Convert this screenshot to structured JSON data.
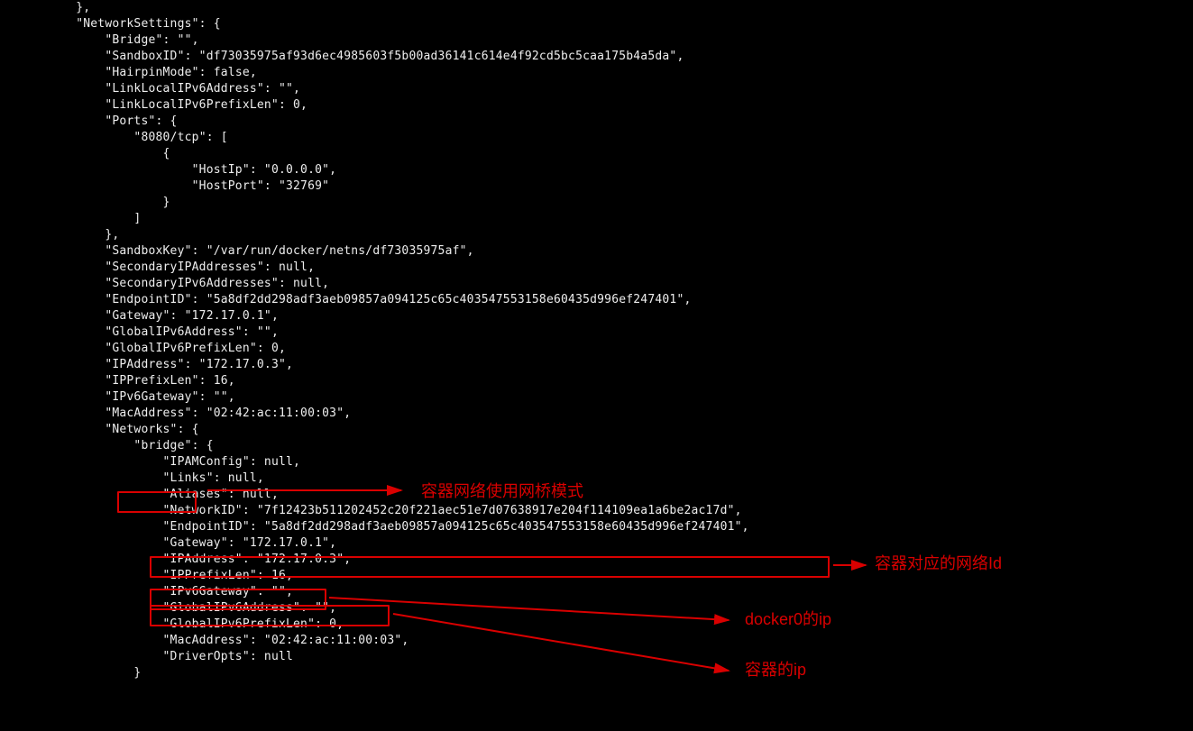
{
  "network_settings": {
    "Bridge": "",
    "SandboxID": "df73035975af93d6ec4985603f5b00ad36141c614e4f92cd5bc5caa175b4a5da",
    "HairpinMode": "false",
    "LinkLocalIPv6Address": "",
    "LinkLocalIPv6PrefixLen": "0",
    "Ports": {
      "port_key": "8080/tcp",
      "HostIp": "0.0.0.0",
      "HostPort": "32769"
    },
    "SandboxKey": "/var/run/docker/netns/df73035975af",
    "SecondaryIPAddresses": "null",
    "SecondaryIPv6Addresses": "null",
    "EndpointID": "5a8df2dd298adf3aeb09857a094125c65c403547553158e60435d996ef247401",
    "Gateway": "172.17.0.1",
    "GlobalIPv6Address": "",
    "GlobalIPv6PrefixLen": "0",
    "IPAddress": "172.17.0.3",
    "IPPrefixLen": "16",
    "IPv6Gateway": "",
    "MacAddress": "02:42:ac:11:00:03",
    "Networks": {
      "bridge": {
        "IPAMConfig": "null",
        "Links": "null",
        "Aliases": "null",
        "NetworkID": "7f12423b511202452c20f221aec51e7d07638917e204f114109ea1a6be2ac17d",
        "EndpointID": "5a8df2dd298adf3aeb09857a094125c65c403547553158e60435d996ef247401",
        "Gateway": "172.17.0.1",
        "IPAddress": "172.17.0.3",
        "IPPrefixLen": "16",
        "IPv6Gateway": "",
        "GlobalIPv6Address": "",
        "GlobalIPv6PrefixLen": "0",
        "MacAddress": "02:42:ac:11:00:03",
        "DriverOpts": "null"
      }
    }
  },
  "annotations": {
    "bridge_mode": "容器网络使用网桥模式",
    "network_id": "容器对应的网络Id",
    "docker0_ip": "docker0的ip",
    "container_ip": "容器的ip"
  }
}
